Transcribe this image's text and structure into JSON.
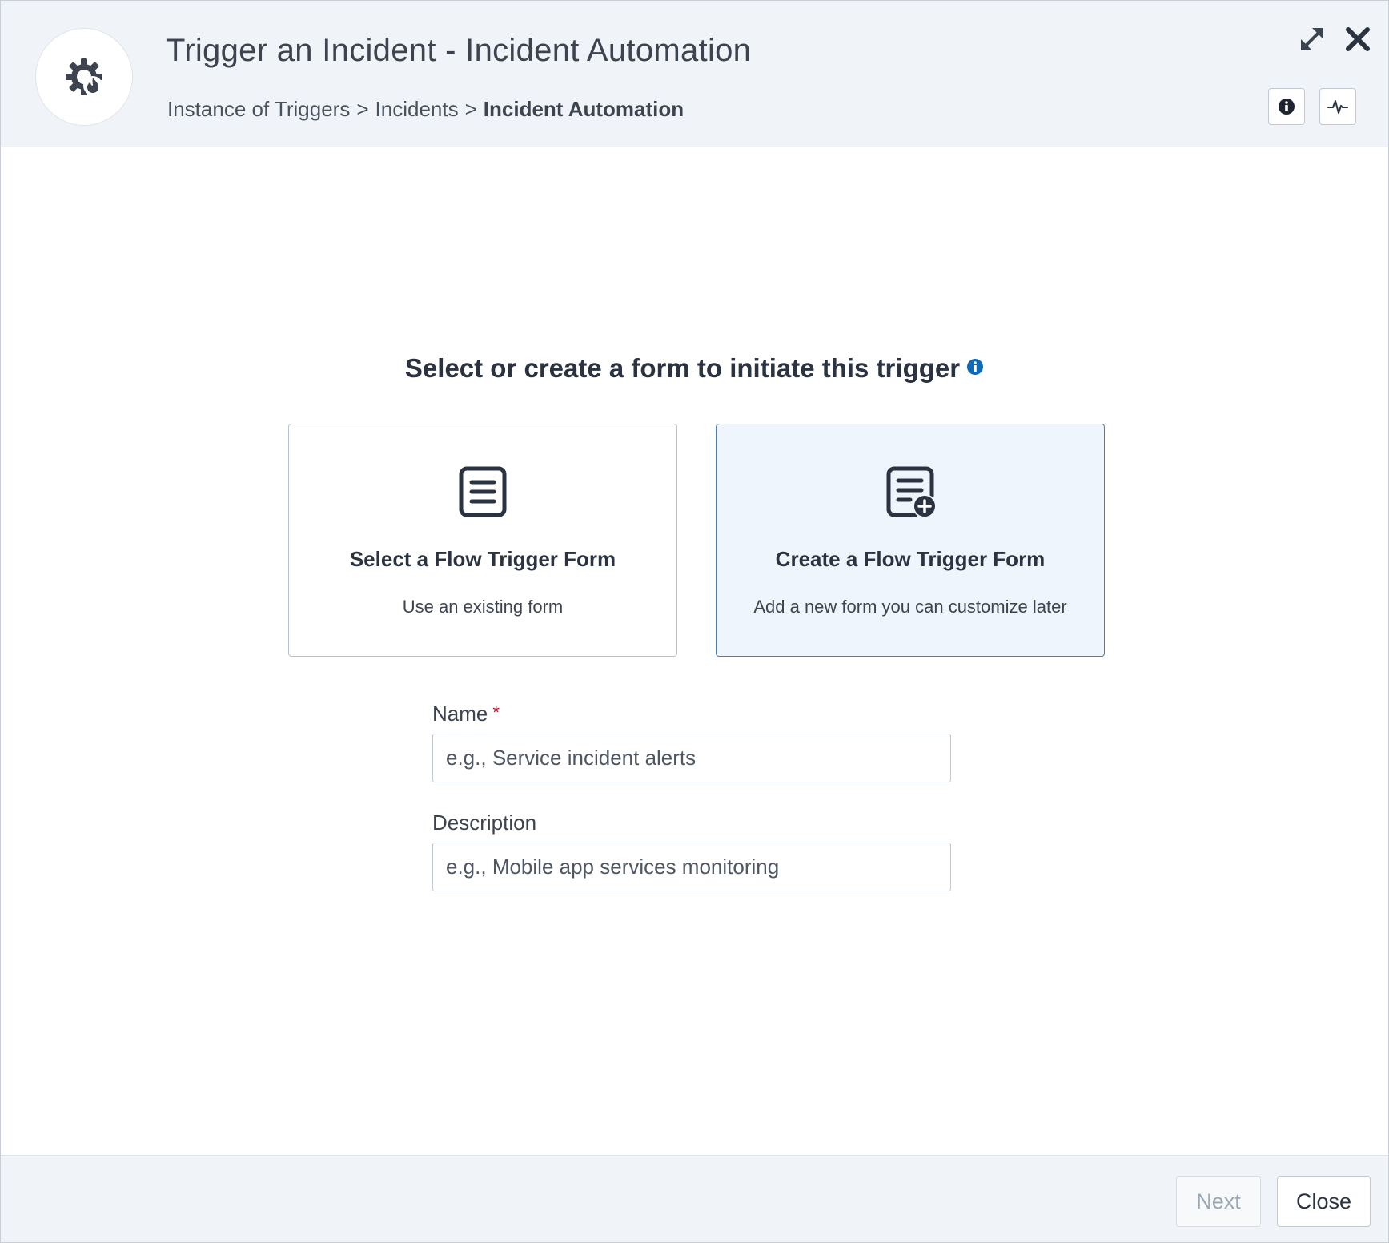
{
  "header": {
    "title": "Trigger an Incident - Incident Automation",
    "breadcrumb": {
      "items": [
        "Instance of Triggers",
        "Incidents"
      ],
      "separator": ">",
      "current": "Incident Automation"
    },
    "icons": {
      "app": "gear-flame-icon",
      "expand": "expand-arrows-icon",
      "close": "close-x-icon",
      "info": "info-icon",
      "activity": "activity-pulse-icon"
    }
  },
  "main": {
    "prompt": "Select or create a form to initiate this trigger",
    "cards": [
      {
        "title": "Select a Flow Trigger Form",
        "subtitle": "Use an existing form",
        "icon": "document-lines-icon",
        "selected": false
      },
      {
        "title": "Create a Flow Trigger Form",
        "subtitle": "Add a new form you can customize later",
        "icon": "document-add-icon",
        "selected": true
      }
    ],
    "form": {
      "name": {
        "label": "Name",
        "required_mark": "*",
        "value": "",
        "placeholder": "e.g., Service incident alerts"
      },
      "description": {
        "label": "Description",
        "value": "",
        "placeholder": "e.g., Mobile app services monitoring"
      }
    }
  },
  "footer": {
    "next_label": "Next",
    "next_disabled": true,
    "close_label": "Close"
  },
  "colors": {
    "accent": "#0e6ab7",
    "selected_card_bg": "#eef5fc",
    "selected_card_border": "#4f7fa6",
    "required": "#c8102e",
    "chrome_bg": "#f0f3f8"
  }
}
